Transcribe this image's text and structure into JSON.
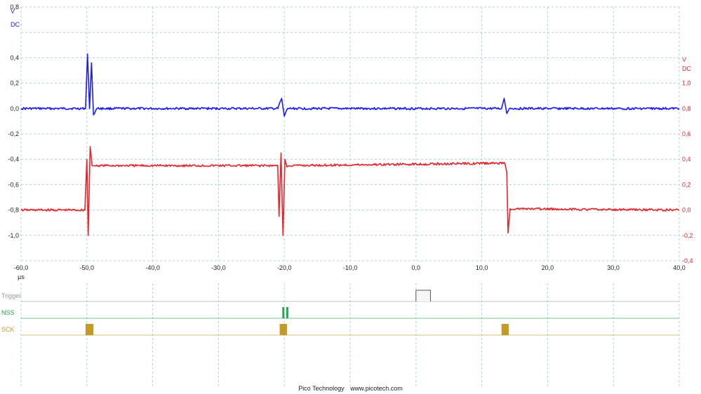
{
  "chart_data": {
    "type": "line",
    "x_unit": "µs",
    "x_ticks": [
      "-60,0",
      "-50,0",
      "-40,0",
      "-30,0",
      "-20,0",
      "-10,0",
      "0,0",
      "10,0",
      "20,0",
      "30,0",
      "40,0"
    ],
    "xlim": [
      -60,
      40
    ],
    "left_axis": {
      "unit": "V",
      "coupling": "DC",
      "color": "#1a1aff",
      "ylim": [
        -1.2,
        0.8
      ],
      "ticks": [
        {
          "v": 0.8,
          "label": "0,8"
        },
        {
          "v": 0.4,
          "label": "0,4"
        },
        {
          "v": 0.2,
          "label": "0,2"
        },
        {
          "v": 0.0,
          "label": "0,0"
        },
        {
          "v": -0.2,
          "label": "-0,2"
        },
        {
          "v": -0.4,
          "label": "-0,4"
        },
        {
          "v": -0.6,
          "label": "-0,6"
        },
        {
          "v": -0.8,
          "label": "-0,8"
        },
        {
          "v": -1.0,
          "label": "-1,0"
        }
      ]
    },
    "right_axis": {
      "unit": "V",
      "coupling": "DC",
      "color": "#e8242a",
      "ylim": [
        -0.4,
        1.6
      ],
      "ticks": [
        {
          "v": 1.0,
          "label": "1,0"
        },
        {
          "v": 0.8,
          "label": "0,8"
        },
        {
          "v": 0.6,
          "label": "0,6"
        },
        {
          "v": 0.4,
          "label": "0,4"
        },
        {
          "v": 0.2,
          "label": "0,2"
        },
        {
          "v": 0.0,
          "label": "0,0"
        },
        {
          "v": -0.2,
          "label": "-0,2"
        },
        {
          "v": -0.4,
          "label": "-0,4"
        }
      ]
    },
    "series": [
      {
        "axis": "left",
        "color": "#1a1aff",
        "x": [
          -60,
          -50.2,
          -49.9,
          -49.6,
          -49.3,
          -49.0,
          -48.5,
          -21.0,
          -20.4,
          -20.0,
          -19.5,
          13.0,
          13.4,
          13.8,
          14.2,
          40
        ],
        "y": [
          0.0,
          0.0,
          0.43,
          0.0,
          0.36,
          -0.05,
          0.0,
          0.0,
          0.08,
          -0.06,
          0.0,
          0.0,
          0.08,
          -0.04,
          0.0,
          0.0
        ]
      },
      {
        "axis": "right",
        "color": "#e8242a",
        "x": [
          -60,
          -50.3,
          -50.0,
          -49.8,
          -49.5,
          -49.2,
          -49.0,
          -21.0,
          -20.8,
          -20.5,
          -20.2,
          -19.9,
          -19.6,
          -19.3,
          13.5,
          13.8,
          14.0,
          14.3,
          40
        ],
        "y": [
          0.0,
          0.0,
          0.4,
          -0.2,
          0.5,
          0.35,
          0.35,
          0.35,
          -0.05,
          0.45,
          -0.2,
          0.4,
          0.34,
          0.35,
          0.37,
          0.3,
          -0.18,
          0.01,
          0.0
        ]
      }
    ],
    "grid": true
  },
  "digital_channels": [
    {
      "name": "Trigger",
      "color": "#999999",
      "pulses": [
        {
          "start": 0.0,
          "end": 2.2
        }
      ],
      "style": "outline"
    },
    {
      "name": "NSS",
      "color": "#1aa84a",
      "pulses": [
        {
          "start": -20.3,
          "end": -20.0
        },
        {
          "start": -19.7,
          "end": -19.4
        }
      ],
      "style": "lines"
    },
    {
      "name": "SCK",
      "color": "#c39a2a",
      "pulses": [
        {
          "start": -50.2,
          "end": -49.0
        },
        {
          "start": -20.7,
          "end": -19.6
        },
        {
          "start": 13.0,
          "end": 14.1
        }
      ],
      "style": "filled"
    }
  ],
  "footer": {
    "brand": "Pico Technology",
    "url": "www.picotech.com"
  }
}
